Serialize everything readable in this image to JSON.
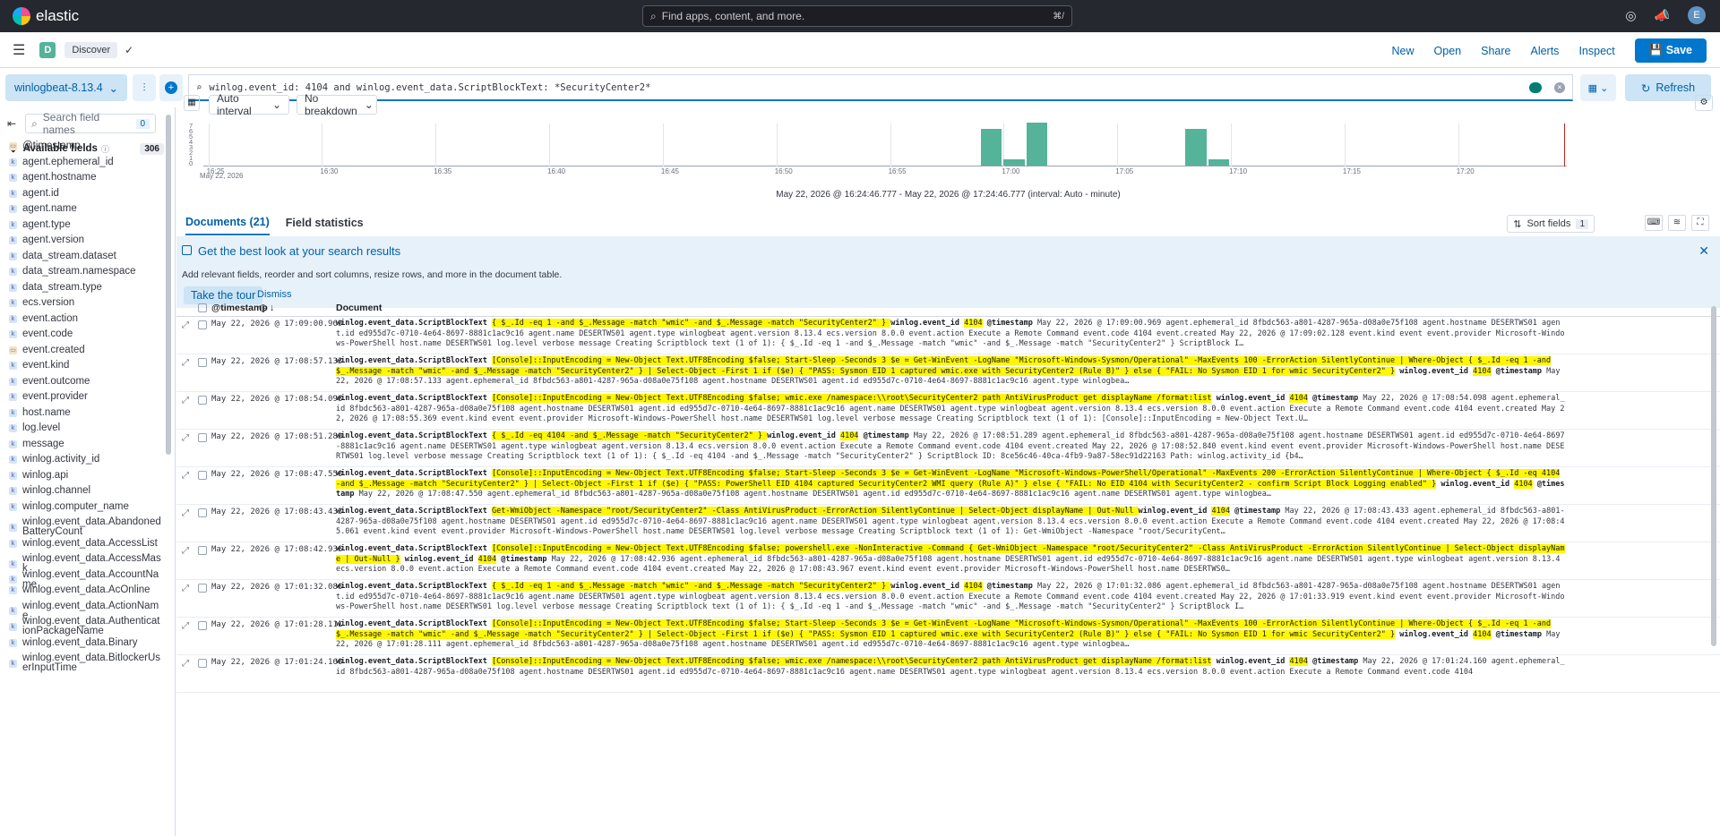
{
  "top": {
    "brand": "elastic",
    "search_placeholder": "Find apps, content, and more.",
    "shortcut": "⌘/",
    "avatar": "E"
  },
  "secondary": {
    "space_initial": "D",
    "breadcrumb": "Discover",
    "menu": [
      "New",
      "Open",
      "Share",
      "Alerts",
      "Inspect"
    ],
    "save": "Save"
  },
  "query": {
    "data_view": "winlogbeat-8.13.4",
    "text": "winlog.event_id: 4104 and winlog.event_data.ScriptBlockText: *SecurityCenter2*",
    "refresh": "Refresh"
  },
  "sidebar": {
    "search_placeholder": "Search field names",
    "filter_count": "0",
    "available_label": "Available fields",
    "available_count": "306",
    "fields": [
      {
        "name": "@timestamp",
        "type": "d"
      },
      {
        "name": "agent.ephemeral_id",
        "type": "k"
      },
      {
        "name": "agent.hostname",
        "type": "k"
      },
      {
        "name": "agent.id",
        "type": "k"
      },
      {
        "name": "agent.name",
        "type": "k"
      },
      {
        "name": "agent.type",
        "type": "k"
      },
      {
        "name": "agent.version",
        "type": "k"
      },
      {
        "name": "data_stream.dataset",
        "type": "k"
      },
      {
        "name": "data_stream.namespace",
        "type": "k"
      },
      {
        "name": "data_stream.type",
        "type": "k"
      },
      {
        "name": "ecs.version",
        "type": "k"
      },
      {
        "name": "event.action",
        "type": "k"
      },
      {
        "name": "event.code",
        "type": "k"
      },
      {
        "name": "event.created",
        "type": "d"
      },
      {
        "name": "event.kind",
        "type": "k"
      },
      {
        "name": "event.outcome",
        "type": "k"
      },
      {
        "name": "event.provider",
        "type": "k"
      },
      {
        "name": "host.name",
        "type": "k"
      },
      {
        "name": "log.level",
        "type": "k"
      },
      {
        "name": "message",
        "type": "k"
      },
      {
        "name": "winlog.activity_id",
        "type": "k"
      },
      {
        "name": "winlog.api",
        "type": "k"
      },
      {
        "name": "winlog.channel",
        "type": "k"
      },
      {
        "name": "winlog.computer_name",
        "type": "k"
      },
      {
        "name": "winlog.event_data.AbandonedBatteryCount",
        "type": "k"
      },
      {
        "name": "winlog.event_data.AccessList",
        "type": "k"
      },
      {
        "name": "winlog.event_data.AccessMask",
        "type": "k"
      },
      {
        "name": "winlog.event_data.AccountName",
        "type": "k"
      },
      {
        "name": "winlog.event_data.AcOnline",
        "type": "k"
      },
      {
        "name": "winlog.event_data.ActionName",
        "type": "k"
      },
      {
        "name": "winlog.event_data.AuthenticationPackageName",
        "type": "k"
      },
      {
        "name": "winlog.event_data.Binary",
        "type": "k"
      },
      {
        "name": "winlog.event_data.BitlockerUserInputTime",
        "type": "k"
      }
    ]
  },
  "chart": {
    "controls": {
      "interval": "Auto interval",
      "breakdown": "No breakdown"
    },
    "y_ticks": [
      "7",
      "6",
      "5",
      "4",
      "3",
      "2",
      "1",
      "0"
    ],
    "x_ticks": [
      "16:25",
      "16:30",
      "16:35",
      "16:40",
      "16:45",
      "16:50",
      "16:55",
      "17:00",
      "17:05",
      "17:10",
      "17:15",
      "17:20"
    ],
    "date_label": "May 22, 2026",
    "range_text": "May 22, 2026 @ 16:24:46.777 - May 22, 2026 @ 17:24:46.777 (interval: Auto - minute)",
    "bars": [
      {
        "minute": "16:59",
        "count": 6
      },
      {
        "minute": "17:00",
        "count": 1
      },
      {
        "minute": "17:01",
        "count": 7
      },
      {
        "minute": "17:08",
        "count": 6
      },
      {
        "minute": "17:09",
        "count": 1
      }
    ]
  },
  "tabs": {
    "documents": "Documents (21)",
    "stats": "Field statistics",
    "sort": "Sort fields",
    "sort_count": "1"
  },
  "callout": {
    "title": "Get the best look at your search results",
    "body": "Add relevant fields, reorder and sort columns, resize rows, and more in the document table.",
    "tour": "Take the tour",
    "dismiss": "Dismiss"
  },
  "table": {
    "col_timestamp": "@timestamp",
    "col_document": "Document"
  },
  "rows": [
    {
      "ts": "May 22, 2026 @ 17:09:00.969",
      "hl": " { $_.Id -eq 1 -and $_.Message -match \"wmic\" -and $_.Message -match \"SecurityCenter2\" } ",
      "rest": "agent.ephemeral_id 8fbdc563-a801-4287-965a-d08a0e75f108 agent.hostname DESERTWS01 agent.id ed955d7c-0710-4e64-8697-8881c1ac9c16 agent.name DESERTWS01 agent.type winlogbeat agent.version 8.13.4 ecs.version 8.0.0 event.action Execute a Remote Command event.code 4104 event.created May 22, 2026 @ 17:09:02.128 event.kind event event.provider Microsoft-Windows-PowerShell host.name DESERTWS01 log.level verbose message Creating Scriptblock text (1 of 1): { $_.Id -eq 1 -and $_.Message -match \"wmic\" -and $_.Message -match \"SecurityCenter2\" } ScriptBlock I…",
      "ts2": "May 22, 2026 @ 17:09:00.969"
    },
    {
      "ts": "May 22, 2026 @ 17:08:57.133",
      "hl": "[Console]::InputEncoding = New-Object Text.UTF8Encoding $false; Start-Sleep -Seconds 3 $e = Get-WinEvent -LogName \"Microsoft-Windows-Sysmon/Operational\" -MaxEvents 100 -ErrorAction SilentlyContinue | Where-Object { $_.Id -eq 1 -and $_.Message -match \"wmic\" -and $_.Message -match \"SecurityCenter2\" } | Select-Object -First 1 if ($e) { \"PASS: Sysmon EID 1 captured wmic.exe with SecurityCenter2 (Rule B)\" } else { \"FAIL: No Sysmon EID 1 for wmic SecurityCenter2\" }",
      "rest": "agent.ephemeral_id 8fbdc563-a801-4287-965a-d08a0e75f108 agent.hostname DESERTWS01 agent.id ed955d7c-0710-4e64-8697-8881c1ac9c16 agent.type winlogbea…",
      "ts2": "May 22, 2026 @ 17:08:57.133"
    },
    {
      "ts": "May 22, 2026 @ 17:08:54.098",
      "hl": "[Console]::InputEncoding = New-Object Text.UTF8Encoding $false; wmic.exe /namespace:\\\\root\\SecurityCenter2 path AntiVirusProduct get displayName /format:list",
      "rest": "agent.ephemeral_id 8fbdc563-a801-4287-965a-d08a0e75f108 agent.hostname DESERTWS01 agent.id ed955d7c-0710-4e64-8697-8881c1ac9c16 agent.name DESERTWS01 agent.type winlogbeat agent.version 8.13.4 ecs.version 8.0.0 event.action Execute a Remote Command event.code 4104 event.created May 22, 2026 @ 17:08:55.369 event.kind event event.provider Microsoft-Windows-PowerShell host.name DESERTWS01 log.level verbose message Creating Scriptblock text (1 of 1): [Console]::InputEncoding = New-Object Text.U…",
      "ts2": "May 22, 2026 @ 17:08:54.098"
    },
    {
      "ts": "May 22, 2026 @ 17:08:51.289",
      "hl": " { $_.Id -eq 4104 -and $_.Message -match \"SecurityCenter2\" } ",
      "rest": "agent.ephemeral_id 8fbdc563-a801-4287-965a-d08a0e75f108 agent.hostname DESERTWS01 agent.id ed955d7c-0710-4e64-8697-8881c1ac9c16 agent.name DESERTWS01 agent.type winlogbeat agent.version 8.13.4 ecs.version 8.0.0 event.action Execute a Remote Command event.code 4104 event.created May 22, 2026 @ 17:08:52.840 event.kind event event.provider Microsoft-Windows-PowerShell host.name DESERTWS01 log.level verbose message Creating Scriptblock text (1 of 1): { $_.Id -eq 4104 -and $_.Message -match \"SecurityCenter2\" } ScriptBlock ID: 8ce56c46-40ca-4fb9-9a87-58ec91d22163 Path: winlog.activity_id {b4…",
      "ts2": "May 22, 2026 @ 17:08:51.289"
    },
    {
      "ts": "May 22, 2026 @ 17:08:47.550",
      "hl": "[Console]::InputEncoding = New-Object Text.UTF8Encoding $false; Start-Sleep -Seconds 3 $e = Get-WinEvent -LogName \"Microsoft-Windows-PowerShell/Operational\" -MaxEvents 200 -ErrorAction SilentlyContinue | Where-Object { $_.Id -eq 4104 -and $_.Message -match \"SecurityCenter2\" } | Select-Object -First 1 if ($e) { \"PASS: PowerShell EID 4104 captured SecurityCenter2 WMI query (Rule A)\" } else { \"FAIL: No EID 4104 with SecurityCenter2 - confirm Script Block Logging enabled\" }",
      "rest": "agent.ephemeral_id 8fbdc563-a801-4287-965a-d08a0e75f108 agent.hostname DESERTWS01 agent.id ed955d7c-0710-4e64-8697-8881c1ac9c16 agent.name DESERTWS01 agent.type winlogbea…",
      "ts2": "May 22, 2026 @ 17:08:47.550"
    },
    {
      "ts": "May 22, 2026 @ 17:08:43.433",
      "hl": " Get-WmiObject -Namespace \"root/SecurityCenter2\" -Class AntiVirusProduct -ErrorAction SilentlyContinue | Select-Object displayName | Out-Null ",
      "rest": "agent.ephemeral_id 8fbdc563-a801-4287-965a-d08a0e75f108 agent.hostname DESERTWS01 agent.id ed955d7c-0710-4e64-8697-8881c1ac9c16 agent.name DESERTWS01 agent.type winlogbeat agent.version 8.13.4 ecs.version 8.0.0 event.action Execute a Remote Command event.code 4104 event.created May 22, 2026 @ 17:08:45.061 event.kind event event.provider Microsoft-Windows-PowerShell host.name DESERTWS01 log.level verbose message Creating Scriptblock text (1 of 1): Get-WmiObject -Namespace \"root/SecurityCent…",
      "ts2": "May 22, 2026 @ 17:08:43.433"
    },
    {
      "ts": "May 22, 2026 @ 17:08:42.936",
      "hl": "[Console]::InputEncoding = New-Object Text.UTF8Encoding $false; powershell.exe -NonInteractive -Command { Get-WmiObject -Namespace \"root/SecurityCenter2\" -Class AntiVirusProduct -ErrorAction SilentlyContinue | Select-Object displayName | Out-Null }",
      "rest": "agent.ephemeral_id 8fbdc563-a801-4287-965a-d08a0e75f108 agent.hostname DESERTWS01 agent.id ed955d7c-0710-4e64-8697-8881c1ac9c16 agent.name DESERTWS01 agent.type winlogbeat agent.version 8.13.4 ecs.version 8.0.0 event.action Execute a Remote Command event.code 4104 event.created May 22, 2026 @ 17:08:43.967 event.kind event event.provider Microsoft-Windows-PowerShell host.name DESERTWS0…",
      "ts2": "May 22, 2026 @ 17:08:42.936"
    },
    {
      "ts": "May 22, 2026 @ 17:01:32.086",
      "hl": " { $_.Id -eq 1 -and $_.Message -match \"wmic\" -and $_.Message -match \"SecurityCenter2\" } ",
      "rest": "agent.ephemeral_id 8fbdc563-a801-4287-965a-d08a0e75f108 agent.hostname DESERTWS01 agent.id ed955d7c-0710-4e64-8697-8881c1ac9c16 agent.name DESERTWS01 agent.type winlogbeat agent.version 8.13.4 ecs.version 8.0.0 event.action Execute a Remote Command event.code 4104 event.created May 22, 2026 @ 17:01:33.919 event.kind event event.provider Microsoft-Windows-PowerShell host.name DESERTWS01 log.level verbose message Creating Scriptblock text (1 of 1): { $_.Id -eq 1 -and $_.Message -match \"wmic\" -and $_.Message -match \"SecurityCenter2\" } ScriptBlock I…",
      "ts2": "May 22, 2026 @ 17:01:32.086"
    },
    {
      "ts": "May 22, 2026 @ 17:01:28.111",
      "hl": "[Console]::InputEncoding = New-Object Text.UTF8Encoding $false; Start-Sleep -Seconds 3 $e = Get-WinEvent -LogName \"Microsoft-Windows-Sysmon/Operational\" -MaxEvents 100 -ErrorAction SilentlyContinue | Where-Object { $_.Id -eq 1 -and $_.Message -match \"wmic\" -and $_.Message -match \"SecurityCenter2\" } | Select-Object -First 1 if ($e) { \"PASS: Sysmon EID 1 captured wmic.exe with SecurityCenter2 (Rule B)\" } else { \"FAIL: No Sysmon EID 1 for wmic SecurityCenter2\" }",
      "rest": "agent.ephemeral_id 8fbdc563-a801-4287-965a-d08a0e75f108 agent.hostname DESERTWS01 agent.id ed955d7c-0710-4e64-8697-8881c1ac9c16 agent.type winlogbea…",
      "ts2": "May 22, 2026 @ 17:01:28.111"
    },
    {
      "ts": "May 22, 2026 @ 17:01:24.160",
      "hl": "[Console]::InputEncoding = New-Object Text.UTF8Encoding $false; wmic.exe /namespace:\\\\root\\SecurityCenter2 path AntiVirusProduct get displayName /format:list",
      "rest": "agent.ephemeral_id 8fbdc563-a801-4287-965a-d08a0e75f108 agent.hostname DESERTWS01 agent.id ed955d7c-0710-4e64-8697-8881c1ac9c16 agent.name DESERTWS01 agent.type winlogbeat agent.version 8.13.4 ecs.version 8.0.0 event.action Execute a Remote Command event.code 4104",
      "ts2": "May 22, 2026 @ 17:01:24.160"
    }
  ],
  "labels": {
    "field_sbt": "winlog.event_data.ScriptBlockText",
    "field_eid": "winlog.event_id",
    "eid": "4104",
    "field_ts": "@timestamp"
  },
  "colors": {
    "accent": "#0077cc",
    "bar": "#54b399",
    "highlight": "#fff700",
    "topbar": "#25282f"
  }
}
